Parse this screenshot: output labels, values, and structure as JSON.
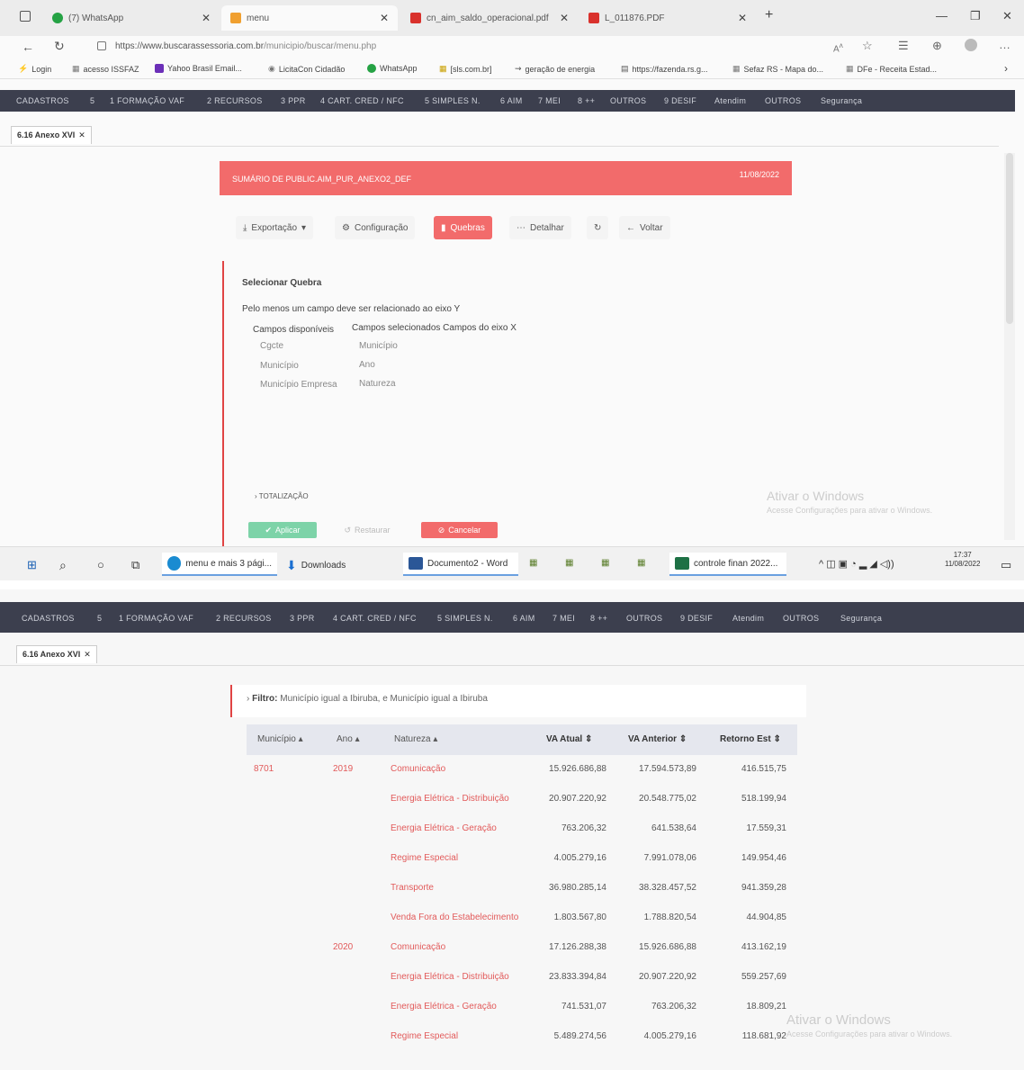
{
  "browser": {
    "tabs": [
      {
        "label": "(7) WhatsApp",
        "color": "#25a244"
      },
      {
        "label": "menu",
        "color": "#f0a030"
      },
      {
        "label": "cn_aim_saldo_operacional.pdf",
        "color": "#d9312c"
      },
      {
        "label": "L_011876.PDF",
        "color": "#d9312c"
      }
    ],
    "url_host": "https://www.buscarassessoria.com.br",
    "url_path": "/municipio/buscar/menu.php",
    "bookmarks": [
      "Login",
      "acesso ISSFAZ",
      "Yahoo Brasil Email...",
      "LicitaCon Cidadão",
      "WhatsApp",
      "[sls.com.br]",
      "geração de energia",
      "https://fazenda.rs.g...",
      "Sefaz RS - Mapa do...",
      "DFe - Receita Estad..."
    ]
  },
  "nav": [
    "CADASTROS",
    "5",
    "1 FORMAÇÃO VAF",
    "2 RECURSOS",
    "3 PPR",
    "4 CART. CRED / NFC",
    "5 SIMPLES N.",
    "6 AIM",
    "7 MEI",
    "8 ++",
    "OUTROS",
    "9 DESIF",
    "Atendim",
    "OUTROS",
    "Segurança"
  ],
  "page_tab": "6.16 Anexo XVI",
  "report": {
    "title": "SUMÁRIO DE PUBLIC.AIM_PUR_ANEXO2_DEF",
    "date": "11/08/2022"
  },
  "toolbar": {
    "export": "Exportação",
    "config": "Configuração",
    "breaks": "Quebras",
    "detail": "Detalhar",
    "back": "Voltar"
  },
  "panel": {
    "heading": "Selecionar Quebra",
    "hint": "Pelo menos um campo deve ser relacionado ao eixo Y",
    "available_label": "Campos disponíveis",
    "selected_label": "Campos selecionados Campos do eixo X",
    "available": [
      "Cgcte",
      "Município",
      "Município Empresa"
    ],
    "selected": [
      "Município",
      "Ano",
      "Natureza"
    ],
    "totalization": "TOTALIZAÇÃO",
    "apply": "Aplicar",
    "restore": "Restaurar",
    "cancel": "Cancelar"
  },
  "watermark": {
    "title": "Ativar o Windows",
    "sub": "Acesse Configurações para ativar o Windows."
  },
  "taskbar": {
    "edge": "menu e mais 3 pági...",
    "downloads": "Downloads",
    "word": "Documento2 - Word",
    "excel": "controle finan 2022...",
    "time": "17:37",
    "date": "11/08/2022"
  },
  "filter": {
    "label": "Filtro:",
    "text": "Município igual a Ibiruba, e Município igual a Ibiruba"
  },
  "table": {
    "headers": [
      "Município",
      "Ano",
      "Natureza",
      "VA Atual",
      "VA Anterior",
      "Retorno Est"
    ],
    "rows": [
      {
        "municipio": "8701",
        "ano": "2019",
        "natureza": "Comunicação",
        "atual": "15.926.686,88",
        "anterior": "17.594.573,89",
        "retorno": "416.515,75"
      },
      {
        "municipio": "",
        "ano": "",
        "natureza": "Energia Elétrica - Distribuição",
        "atual": "20.907.220,92",
        "anterior": "20.548.775,02",
        "retorno": "518.199,94"
      },
      {
        "municipio": "",
        "ano": "",
        "natureza": "Energia Elétrica - Geração",
        "atual": "763.206,32",
        "anterior": "641.538,64",
        "retorno": "17.559,31"
      },
      {
        "municipio": "",
        "ano": "",
        "natureza": "Regime Especial",
        "atual": "4.005.279,16",
        "anterior": "7.991.078,06",
        "retorno": "149.954,46"
      },
      {
        "municipio": "",
        "ano": "",
        "natureza": "Transporte",
        "atual": "36.980.285,14",
        "anterior": "38.328.457,52",
        "retorno": "941.359,28"
      },
      {
        "municipio": "",
        "ano": "",
        "natureza": "Venda Fora do Estabelecimento",
        "atual": "1.803.567,80",
        "anterior": "1.788.820,54",
        "retorno": "44.904,85"
      },
      {
        "municipio": "",
        "ano": "2020",
        "natureza": "Comunicação",
        "atual": "17.126.288,38",
        "anterior": "15.926.686,88",
        "retorno": "413.162,19"
      },
      {
        "municipio": "",
        "ano": "",
        "natureza": "Energia Elétrica - Distribuição",
        "atual": "23.833.394,84",
        "anterior": "20.907.220,92",
        "retorno": "559.257,69"
      },
      {
        "municipio": "",
        "ano": "",
        "natureza": "Energia Elétrica - Geração",
        "atual": "741.531,07",
        "anterior": "763.206,32",
        "retorno": "18.809,21"
      },
      {
        "municipio": "",
        "ano": "",
        "natureza": "Regime Especial",
        "atual": "5.489.274,56",
        "anterior": "4.005.279,16",
        "retorno": "118.681,92"
      }
    ]
  }
}
